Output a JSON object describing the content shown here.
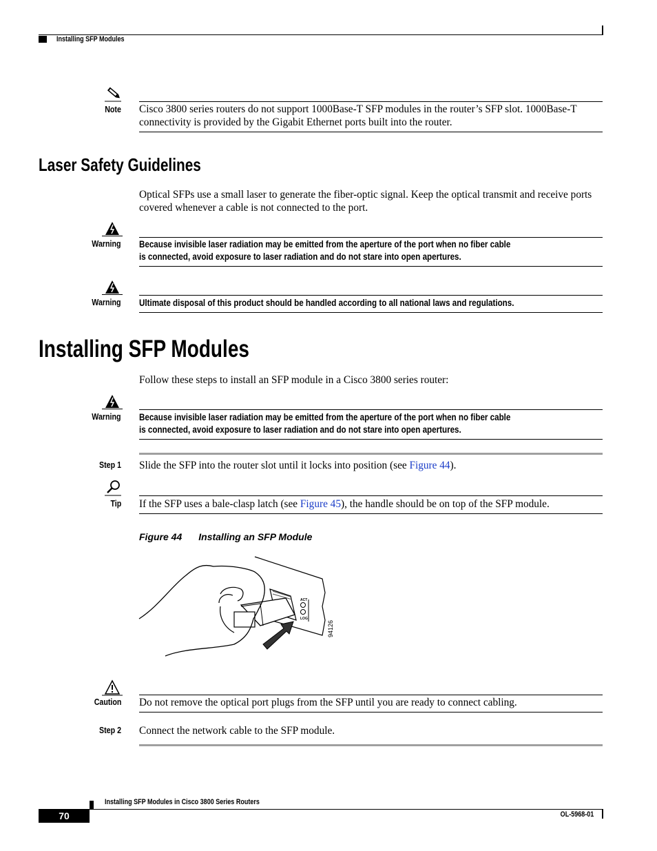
{
  "header": {
    "section_title": "Installing SFP Modules"
  },
  "note": {
    "label": "Note",
    "icon": "pencil-icon",
    "text": "Cisco 3800 series routers do not support 1000Base-T SFP modules in the router’s SFP slot. 1000Base-T connectivity is provided by the Gigabit Ethernet ports built into the router."
  },
  "laser_section": {
    "title": "Laser Safety Guidelines",
    "intro": "Optical SFPs use a small laser to generate the fiber-optic signal. Keep the optical transmit and receive ports covered whenever a cable is not connected to the port.",
    "warnings": [
      {
        "label": "Warning",
        "icon": "electric-warning-icon",
        "line1": "Because invisible laser radiation may be emitted from the aperture of the port when no fiber cable",
        "line2": "is connected, avoid exposure to laser radiation and do not stare into open apertures."
      },
      {
        "label": "Warning",
        "icon": "electric-warning-icon",
        "line1": "Ultimate disposal of this product should be handled according to all national laws and regulations."
      }
    ]
  },
  "install_section": {
    "title": "Installing SFP Modules",
    "intro": "Follow these steps to install an SFP module in a Cisco 3800 series router:",
    "warning": {
      "label": "Warning",
      "icon": "electric-warning-icon",
      "line1": "Because invisible laser radiation may be emitted from the aperture of the port when no fiber cable",
      "line2": "is connected, avoid exposure to laser radiation and do not stare into open apertures."
    },
    "step1": {
      "label": "Step 1",
      "text_before": "Slide the SFP into the router slot until it locks into position (see ",
      "link": "Figure 44",
      "text_after": ")."
    },
    "tip": {
      "label": "Tip",
      "icon": "magnifier-icon",
      "text_before": "If the SFP uses a bale-clasp latch (see ",
      "link": "Figure 45",
      "text_after": "), the handle should be on top of the SFP module."
    },
    "figure": {
      "number": "Figure 44",
      "caption": "Installing an SFP Module",
      "id_label": "94126",
      "port_labels": [
        "ACT",
        "LOG"
      ]
    },
    "caution": {
      "label": "Caution",
      "icon": "caution-triangle-icon",
      "text": "Do not remove the optical port plugs from the SFP until you are ready to connect cabling."
    },
    "step2": {
      "label": "Step 2",
      "text": "Connect the network cable to the SFP module."
    }
  },
  "footer": {
    "doc_title": "Installing SFP Modules in Cisco 3800 Series Routers",
    "page_number": "70",
    "doc_number": "OL-5968-01"
  },
  "colors": {
    "link": "#1a3cc8",
    "step_rule": "#a0a0a0"
  }
}
